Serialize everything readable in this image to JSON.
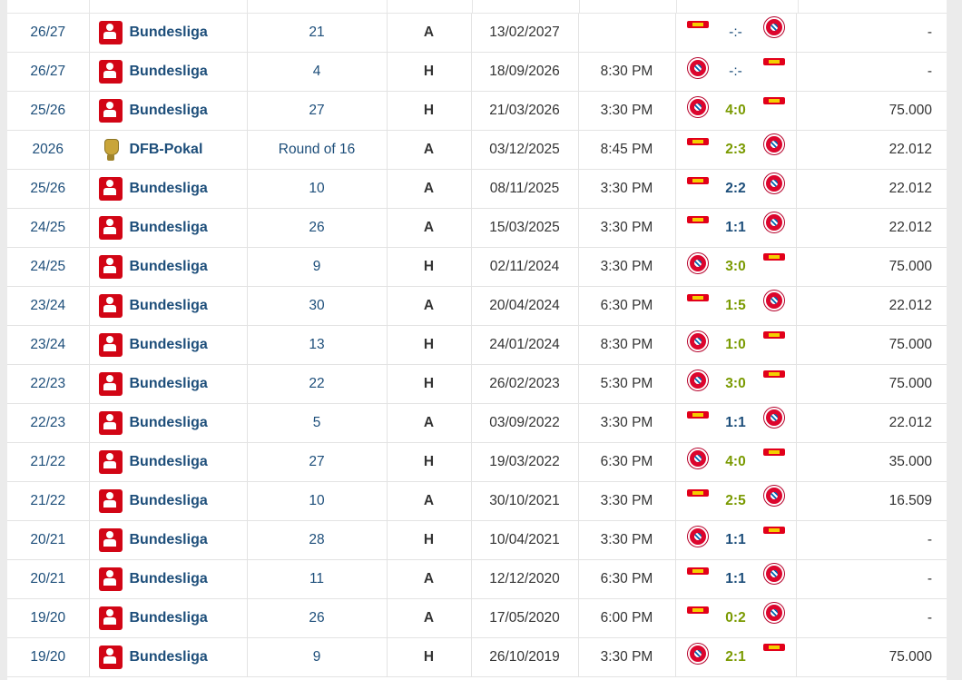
{
  "colors": {
    "link": "#1d4e7a",
    "win": "#7a9a01",
    "bayern": "#dc052d",
    "union": "#e2001a"
  },
  "icons": {
    "bundesliga": "bundesliga-logo",
    "dfb_pokal": "dfb-pokal-logo",
    "home_team": "club-crest-icon",
    "away_team": "club-crest-icon"
  },
  "rows": [
    {
      "season": "26/27",
      "competition": "Bundesliga",
      "logo": "bundesliga",
      "round": "21",
      "venue": "A",
      "date": "13/02/2027",
      "time": "",
      "left": "fcu",
      "right": "fcb",
      "score": "-:-",
      "result": "none",
      "attendance": "-"
    },
    {
      "season": "26/27",
      "competition": "Bundesliga",
      "logo": "bundesliga",
      "round": "4",
      "venue": "H",
      "date": "18/09/2026",
      "time": "8:30 PM",
      "left": "fcb",
      "right": "fcu",
      "score": "-:-",
      "result": "none",
      "attendance": "-"
    },
    {
      "season": "25/26",
      "competition": "Bundesliga",
      "logo": "bundesliga",
      "round": "27",
      "venue": "H",
      "date": "21/03/2026",
      "time": "3:30 PM",
      "left": "fcb",
      "right": "fcu",
      "score": "4:0",
      "result": "win",
      "attendance": "75.000"
    },
    {
      "season": "2026",
      "competition": "DFB-Pokal",
      "logo": "pokal",
      "round": "Round of 16",
      "venue": "A",
      "date": "03/12/2025",
      "time": "8:45 PM",
      "left": "fcu",
      "right": "fcb",
      "score": "2:3",
      "result": "win",
      "attendance": "22.012"
    },
    {
      "season": "25/26",
      "competition": "Bundesliga",
      "logo": "bundesliga",
      "round": "10",
      "venue": "A",
      "date": "08/11/2025",
      "time": "3:30 PM",
      "left": "fcu",
      "right": "fcb",
      "score": "2:2",
      "result": "draw",
      "attendance": "22.012"
    },
    {
      "season": "24/25",
      "competition": "Bundesliga",
      "logo": "bundesliga",
      "round": "26",
      "venue": "A",
      "date": "15/03/2025",
      "time": "3:30 PM",
      "left": "fcu",
      "right": "fcb",
      "score": "1:1",
      "result": "draw",
      "attendance": "22.012"
    },
    {
      "season": "24/25",
      "competition": "Bundesliga",
      "logo": "bundesliga",
      "round": "9",
      "venue": "H",
      "date": "02/11/2024",
      "time": "3:30 PM",
      "left": "fcb",
      "right": "fcu",
      "score": "3:0",
      "result": "win",
      "attendance": "75.000"
    },
    {
      "season": "23/24",
      "competition": "Bundesliga",
      "logo": "bundesliga",
      "round": "30",
      "venue": "A",
      "date": "20/04/2024",
      "time": "6:30 PM",
      "left": "fcu",
      "right": "fcb",
      "score": "1:5",
      "result": "win",
      "attendance": "22.012"
    },
    {
      "season": "23/24",
      "competition": "Bundesliga",
      "logo": "bundesliga",
      "round": "13",
      "venue": "H",
      "date": "24/01/2024",
      "time": "8:30 PM",
      "left": "fcb",
      "right": "fcu",
      "score": "1:0",
      "result": "win",
      "attendance": "75.000"
    },
    {
      "season": "22/23",
      "competition": "Bundesliga",
      "logo": "bundesliga",
      "round": "22",
      "venue": "H",
      "date": "26/02/2023",
      "time": "5:30 PM",
      "left": "fcb",
      "right": "fcu",
      "score": "3:0",
      "result": "win",
      "attendance": "75.000"
    },
    {
      "season": "22/23",
      "competition": "Bundesliga",
      "logo": "bundesliga",
      "round": "5",
      "venue": "A",
      "date": "03/09/2022",
      "time": "3:30 PM",
      "left": "fcu",
      "right": "fcb",
      "score": "1:1",
      "result": "draw",
      "attendance": "22.012"
    },
    {
      "season": "21/22",
      "competition": "Bundesliga",
      "logo": "bundesliga",
      "round": "27",
      "venue": "H",
      "date": "19/03/2022",
      "time": "6:30 PM",
      "left": "fcb",
      "right": "fcu",
      "score": "4:0",
      "result": "win",
      "attendance": "35.000"
    },
    {
      "season": "21/22",
      "competition": "Bundesliga",
      "logo": "bundesliga",
      "round": "10",
      "venue": "A",
      "date": "30/10/2021",
      "time": "3:30 PM",
      "left": "fcu",
      "right": "fcb",
      "score": "2:5",
      "result": "win",
      "attendance": "16.509"
    },
    {
      "season": "20/21",
      "competition": "Bundesliga",
      "logo": "bundesliga",
      "round": "28",
      "venue": "H",
      "date": "10/04/2021",
      "time": "3:30 PM",
      "left": "fcb",
      "right": "fcu",
      "score": "1:1",
      "result": "draw",
      "attendance": "-"
    },
    {
      "season": "20/21",
      "competition": "Bundesliga",
      "logo": "bundesliga",
      "round": "11",
      "venue": "A",
      "date": "12/12/2020",
      "time": "6:30 PM",
      "left": "fcu",
      "right": "fcb",
      "score": "1:1",
      "result": "draw",
      "attendance": "-"
    },
    {
      "season": "19/20",
      "competition": "Bundesliga",
      "logo": "bundesliga",
      "round": "26",
      "venue": "A",
      "date": "17/05/2020",
      "time": "6:00 PM",
      "left": "fcu",
      "right": "fcb",
      "score": "0:2",
      "result": "win",
      "attendance": "-"
    },
    {
      "season": "19/20",
      "competition": "Bundesliga",
      "logo": "bundesliga",
      "round": "9",
      "venue": "H",
      "date": "26/10/2019",
      "time": "3:30 PM",
      "left": "fcb",
      "right": "fcu",
      "score": "2:1",
      "result": "win",
      "attendance": "75.000"
    }
  ]
}
